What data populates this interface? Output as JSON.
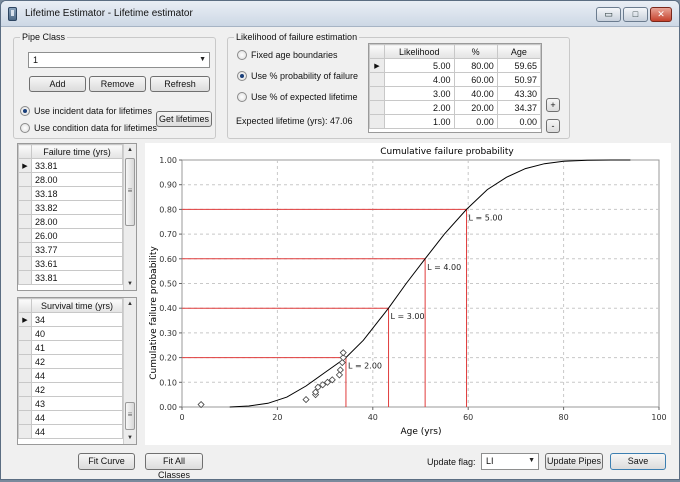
{
  "window": {
    "title": "Lifetime Estimator - Lifetime estimator",
    "controls": {
      "minimize": "▭",
      "maximize": "□",
      "close": "✕"
    }
  },
  "pipe_class": {
    "group_label": "Pipe Class",
    "selected": "1",
    "add_label": "Add",
    "remove_label": "Remove",
    "refresh_label": "Refresh",
    "radio_incident": "Use incident data for lifetimes",
    "radio_condition": "Use condition data for lifetimes",
    "radio_selected": "incident",
    "get_lifetimes_label": "Get lifetimes"
  },
  "likelihood": {
    "group_label": "Likelihood of failure estimation",
    "radio_fixed": "Fixed age boundaries",
    "radio_prob": "Use % probability of failure",
    "radio_expected": "Use % of expected lifetime",
    "radio_selected": "prob",
    "expected_lifetime": "Expected lifetime (yrs): 47.06",
    "add_row_label": "+",
    "remove_row_label": "-",
    "table": {
      "headers": [
        "Likelihood",
        "%",
        "Age"
      ],
      "rows": [
        [
          "5.00",
          "80.00",
          "59.65"
        ],
        [
          "4.00",
          "60.00",
          "50.97"
        ],
        [
          "3.00",
          "40.00",
          "43.30"
        ],
        [
          "2.00",
          "20.00",
          "34.37"
        ],
        [
          "1.00",
          "0.00",
          "0.00"
        ]
      ],
      "current_row": 0
    }
  },
  "failure_list": {
    "header": "Failure time (yrs)",
    "rows": [
      "33.81",
      "28.00",
      "33.18",
      "33.82",
      "28.00",
      "26.00",
      "33.77",
      "33.61",
      "33.81"
    ],
    "current_row": 0
  },
  "survival_list": {
    "header": "Survival time (yrs)",
    "rows": [
      "34",
      "40",
      "41",
      "42",
      "44",
      "42",
      "43",
      "44",
      "44"
    ],
    "current_row": 0
  },
  "bottom": {
    "fit_curve_label": "Fit Curve",
    "fit_all_label": "Fit All Classes",
    "update_flag_label": "Update flag:",
    "update_flag_value": "LI",
    "update_pipes_label": "Update Pipes",
    "save_label": "Save"
  },
  "icons": {
    "row_pointer": "▶",
    "scroll_up": "▲",
    "scroll_down": "▼",
    "dropdown": "▼"
  },
  "colors": {
    "curve": "#000000",
    "threshold_lines": "#e03c3c",
    "grid": "#c8c8c8",
    "markers": "#444444"
  },
  "chart_data": {
    "type": "line",
    "title": "Cumulative failure probability",
    "xlabel": "Age (yrs)",
    "ylabel": "Cumulative failure probability",
    "xlim": [
      0,
      100
    ],
    "ylim": [
      0,
      1
    ],
    "xticks": [
      "0",
      "20",
      "40",
      "60",
      "80",
      "100"
    ],
    "yticks": [
      "0.00",
      "0.10",
      "0.20",
      "0.30",
      "0.40",
      "0.50",
      "0.60",
      "0.70",
      "0.80",
      "0.90",
      "1.00"
    ],
    "grid": true,
    "curve": {
      "x": [
        10,
        14,
        18,
        22,
        26,
        30,
        34.37,
        38,
        43.3,
        47,
        50.97,
        55,
        59.65,
        64,
        68,
        72,
        76,
        80,
        85,
        90,
        94
      ],
      "y": [
        0.0,
        0.004,
        0.015,
        0.04,
        0.085,
        0.14,
        0.2,
        0.27,
        0.4,
        0.5,
        0.6,
        0.7,
        0.8,
        0.88,
        0.93,
        0.965,
        0.985,
        0.995,
        0.999,
        1.0,
        1.0
      ]
    },
    "points": {
      "x": [
        4,
        26,
        28,
        28,
        28.5,
        29.5,
        30.5,
        31.5,
        33,
        33.2,
        33.6,
        33.8,
        33.8
      ],
      "y": [
        0.01,
        0.03,
        0.05,
        0.06,
        0.08,
        0.09,
        0.1,
        0.11,
        0.13,
        0.15,
        0.18,
        0.2,
        0.22
      ]
    },
    "thresholds": [
      {
        "label": "L = 2.00",
        "x": 34.37,
        "y": 0.2
      },
      {
        "label": "L = 3.00",
        "x": 43.3,
        "y": 0.4
      },
      {
        "label": "L = 4.00",
        "x": 50.97,
        "y": 0.6
      },
      {
        "label": "L = 5.00",
        "x": 59.65,
        "y": 0.8
      }
    ]
  }
}
